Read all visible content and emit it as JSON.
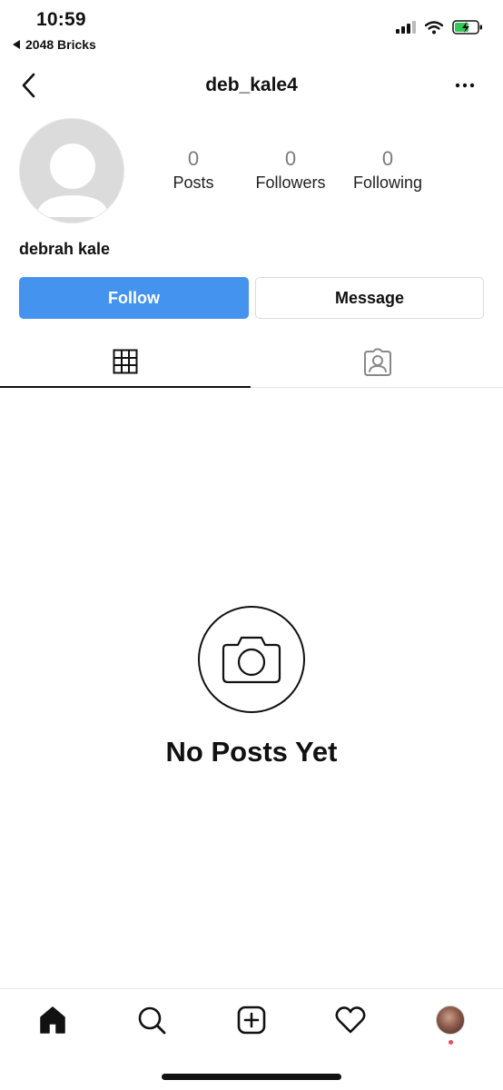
{
  "status_bar": {
    "time": "10:59",
    "back_app_label": "2048 Bricks",
    "icons": [
      "signal-icon",
      "wifi-icon",
      "battery-charging-icon"
    ]
  },
  "header": {
    "username": "deb_kale4",
    "back_icon": "chevron-left-icon",
    "more_icon": "more-horizontal-icon"
  },
  "profile": {
    "display_name": "debrah kale",
    "stats": [
      {
        "value": "0",
        "label": "Posts"
      },
      {
        "value": "0",
        "label": "Followers"
      },
      {
        "value": "0",
        "label": "Following"
      }
    ],
    "follow_label": "Follow",
    "message_label": "Message"
  },
  "tabs": [
    {
      "name": "grid",
      "icon": "grid-icon",
      "active": true
    },
    {
      "name": "tagged",
      "icon": "tagged-person-icon",
      "active": false
    }
  ],
  "empty_state": {
    "icon": "camera-icon",
    "title": "No Posts Yet"
  },
  "bottom_nav": {
    "items": [
      "home-icon",
      "search-icon",
      "new-post-icon",
      "activity-heart-icon",
      "profile-avatar"
    ],
    "active": "home-icon",
    "notification_dot": true
  },
  "colors": {
    "follow_button": "#4493ee",
    "avatar_placeholder": "#dbdbdb",
    "notification_dot": "#ed4956",
    "stat_value": "#7a7a7a"
  }
}
